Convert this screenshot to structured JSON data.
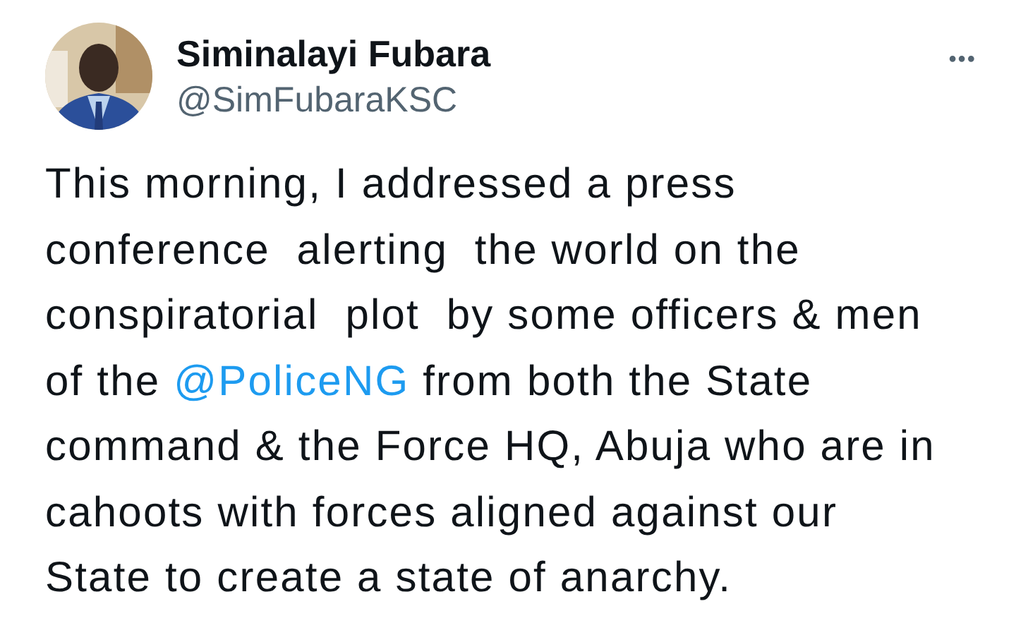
{
  "author": {
    "name": "Siminalayi Fubara",
    "handle": "@SimFubaraKSC"
  },
  "menu": {
    "label": "•••"
  },
  "body": [
    {
      "kind": "text",
      "text": "This morning, I addressed a press\nconference  alerting  the world on the\nconspiratorial  plot  by some officers & men\nof the "
    },
    {
      "kind": "mention",
      "text": "@PoliceNG"
    },
    {
      "kind": "text",
      "text": " from both the State\ncommand & the Force HQ, Abuja who are in\ncahoots with forces aligned against our\nState to create a state of anarchy."
    }
  ]
}
